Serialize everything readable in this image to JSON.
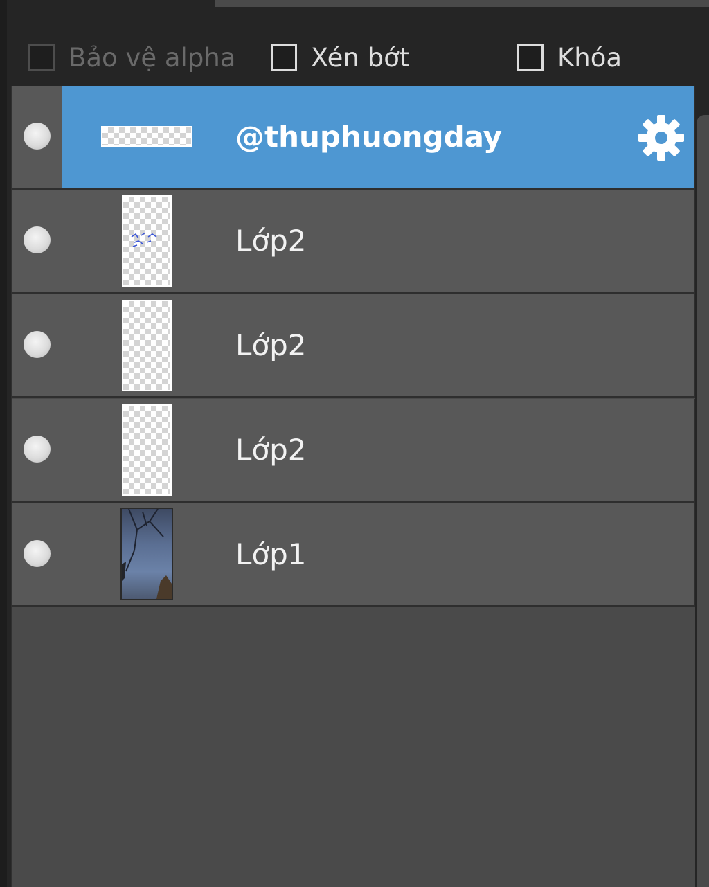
{
  "options": {
    "alpha_protect": {
      "label": "Bảo vệ alpha",
      "checked": false,
      "enabled": false
    },
    "clipping": {
      "label": "Xén bớt",
      "checked": false,
      "enabled": true
    },
    "lock": {
      "label": "Khóa",
      "checked": false,
      "enabled": true
    }
  },
  "layers": [
    {
      "name": "@thuphuongday",
      "visible": true,
      "selected": true,
      "thumbnail": "wide-transparent",
      "icon": "gear-icon"
    },
    {
      "name": "Lớp2",
      "visible": true,
      "selected": false,
      "thumbnail": "tall-transparent-with-blue-strokes"
    },
    {
      "name": "Lớp2",
      "visible": true,
      "selected": false,
      "thumbnail": "tall-transparent"
    },
    {
      "name": "Lớp2",
      "visible": true,
      "selected": false,
      "thumbnail": "tall-transparent"
    },
    {
      "name": "Lớp1",
      "visible": true,
      "selected": false,
      "thumbnail": "photo-sky-branches"
    }
  ],
  "colors": {
    "selection": "#4e97d2",
    "row": "#585858",
    "panel": "#4a4a4a",
    "toolbar": "#252525"
  }
}
